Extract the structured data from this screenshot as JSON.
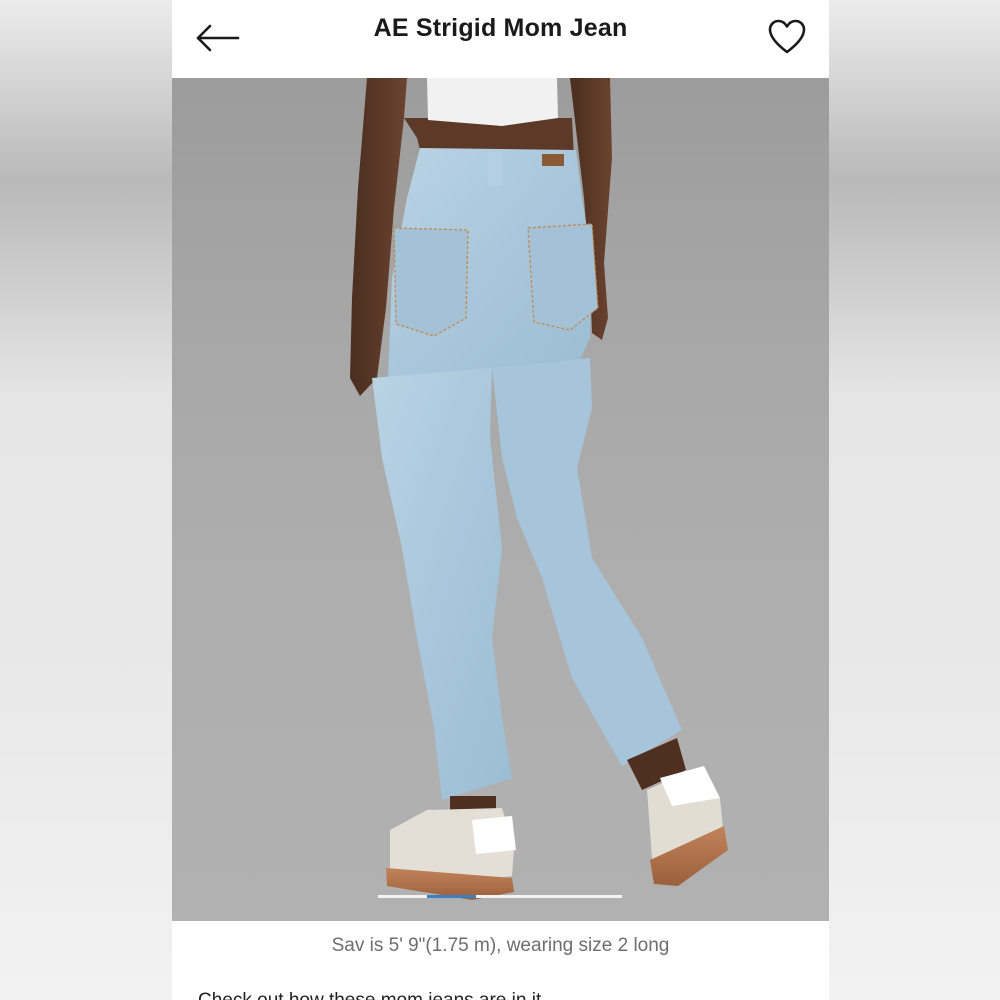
{
  "header": {
    "title": "AE Strigid Mom Jean",
    "back_icon": "arrow-left-icon",
    "favorite_icon": "heart-outline-icon"
  },
  "gallery": {
    "image_description_subject": "product-photo",
    "page_indicator": {
      "total_pages": 5,
      "current_page": 2
    },
    "colors": {
      "indicator_active": "#3d7ec2",
      "indicator_track": "#f2f2f2"
    }
  },
  "caption": "Sav is 5' 9\"(1.75 m), wearing size 2 long",
  "description_partial": "Check out how these mom jeans are in it..."
}
